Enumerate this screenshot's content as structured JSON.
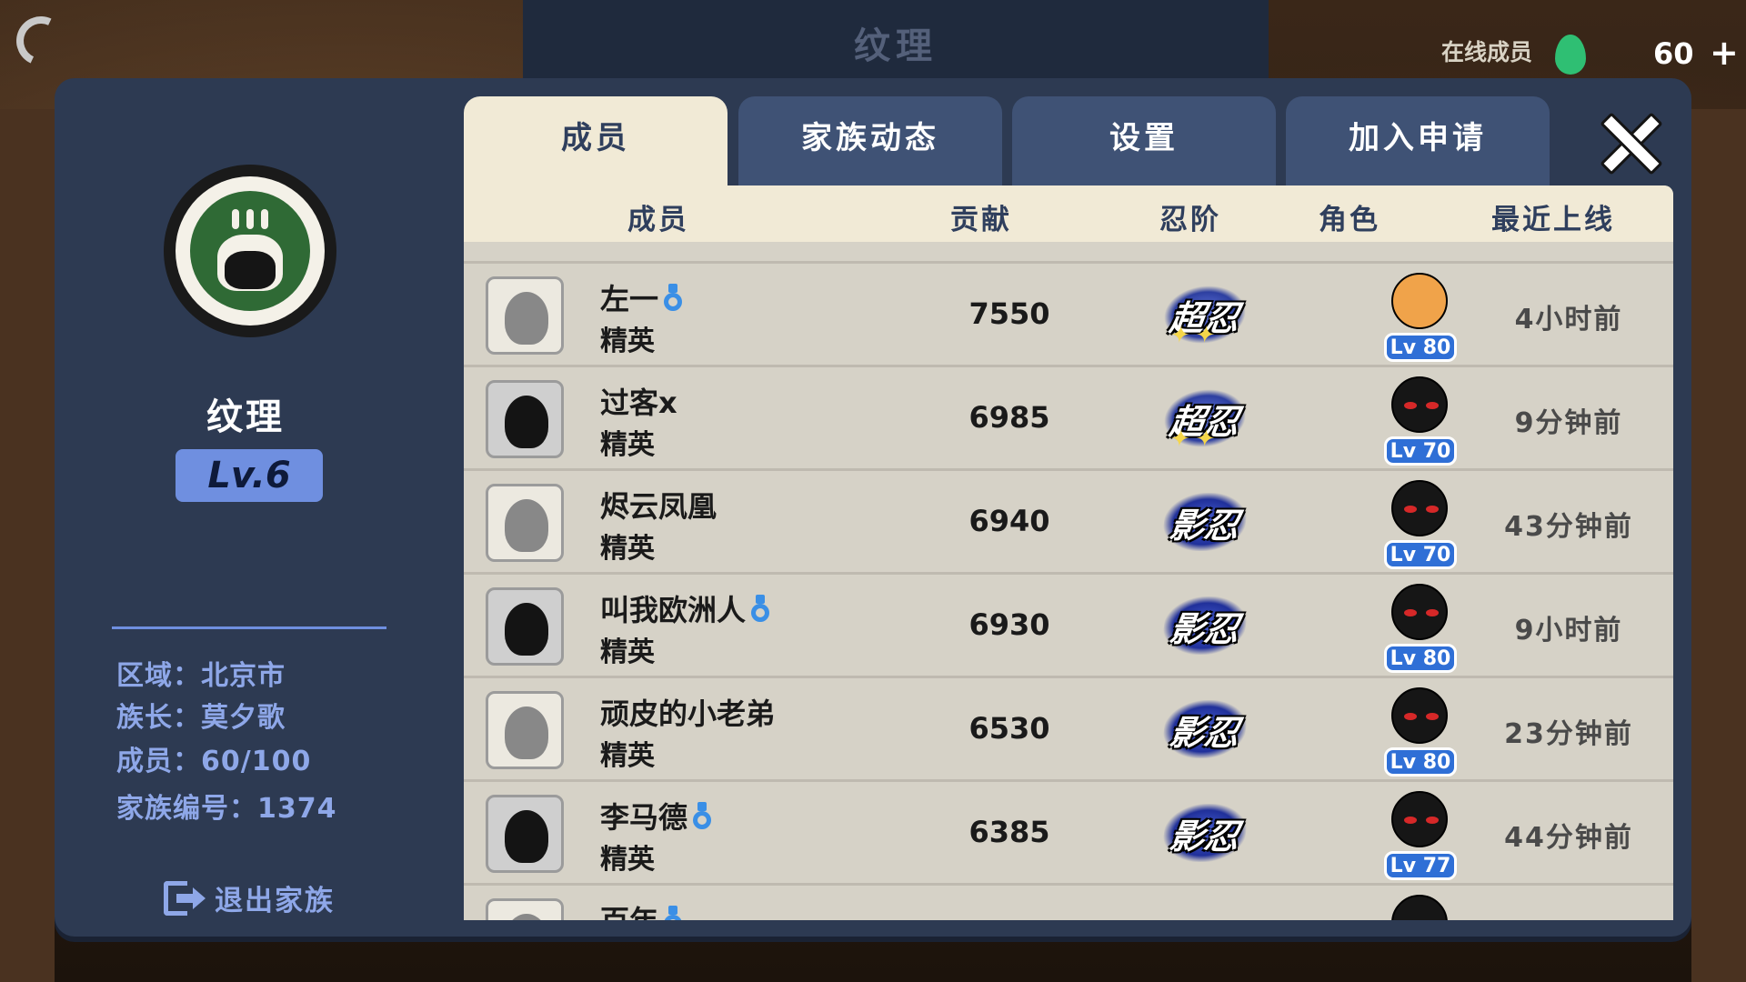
{
  "background": {
    "title": "纹理"
  },
  "topbar": {
    "online_label": "在线成员",
    "member_count": "60",
    "plus_label": "+"
  },
  "clan": {
    "name": "纹理",
    "level": "Lv.6",
    "info": [
      "区域：北京市",
      "族长：莫夕歌",
      "成员：60/100",
      "家族编号：1374"
    ],
    "leave_label": "退出家族"
  },
  "tabs": [
    {
      "label": "成员",
      "active": true
    },
    {
      "label": "家族动态",
      "active": false
    },
    {
      "label": "设置",
      "active": false
    },
    {
      "label": "加入申请",
      "active": false
    }
  ],
  "table": {
    "headers": [
      "成员",
      "贡献",
      "忍阶",
      "角色",
      "最近上线"
    ],
    "rows": [
      {
        "name": "左一",
        "gender_icon": "male-icon",
        "rank": "精英",
        "contribution": "7550",
        "ninja_rank": "超忍",
        "role_level": "Lv 80",
        "last_online": "4小时前"
      },
      {
        "name": "过客x",
        "gender_icon": "",
        "rank": "精英",
        "contribution": "6985",
        "ninja_rank": "超忍",
        "role_level": "Lv 70",
        "last_online": "9分钟前"
      },
      {
        "name": "烬云凤凰",
        "gender_icon": "",
        "rank": "精英",
        "contribution": "6940",
        "ninja_rank": "影忍",
        "role_level": "Lv 70",
        "last_online": "43分钟前"
      },
      {
        "name": "叫我欧洲人",
        "gender_icon": "male-icon",
        "rank": "精英",
        "contribution": "6930",
        "ninja_rank": "影忍",
        "role_level": "Lv 80",
        "last_online": "9小时前"
      },
      {
        "name": "顽皮的小老弟",
        "gender_icon": "",
        "rank": "精英",
        "contribution": "6530",
        "ninja_rank": "影忍",
        "role_level": "Lv 80",
        "last_online": "23分钟前"
      },
      {
        "name": "李马德",
        "gender_icon": "male-icon",
        "rank": "精英",
        "contribution": "6385",
        "ninja_rank": "影忍",
        "role_level": "Lv 77",
        "last_online": "44分钟前"
      },
      {
        "name": "百年",
        "gender_icon": "male-icon",
        "rank": "",
        "contribution": "",
        "ninja_rank": "",
        "role_level": "",
        "last_online": ""
      }
    ]
  },
  "colors": {
    "panel": "#2d3a52",
    "tab_active": "#f1ead6",
    "tab_inactive": "#3f5275",
    "accent_blue": "#6f8fe0",
    "level_badge": "#2f6fd6",
    "male_icon": "#3a8fe6"
  }
}
